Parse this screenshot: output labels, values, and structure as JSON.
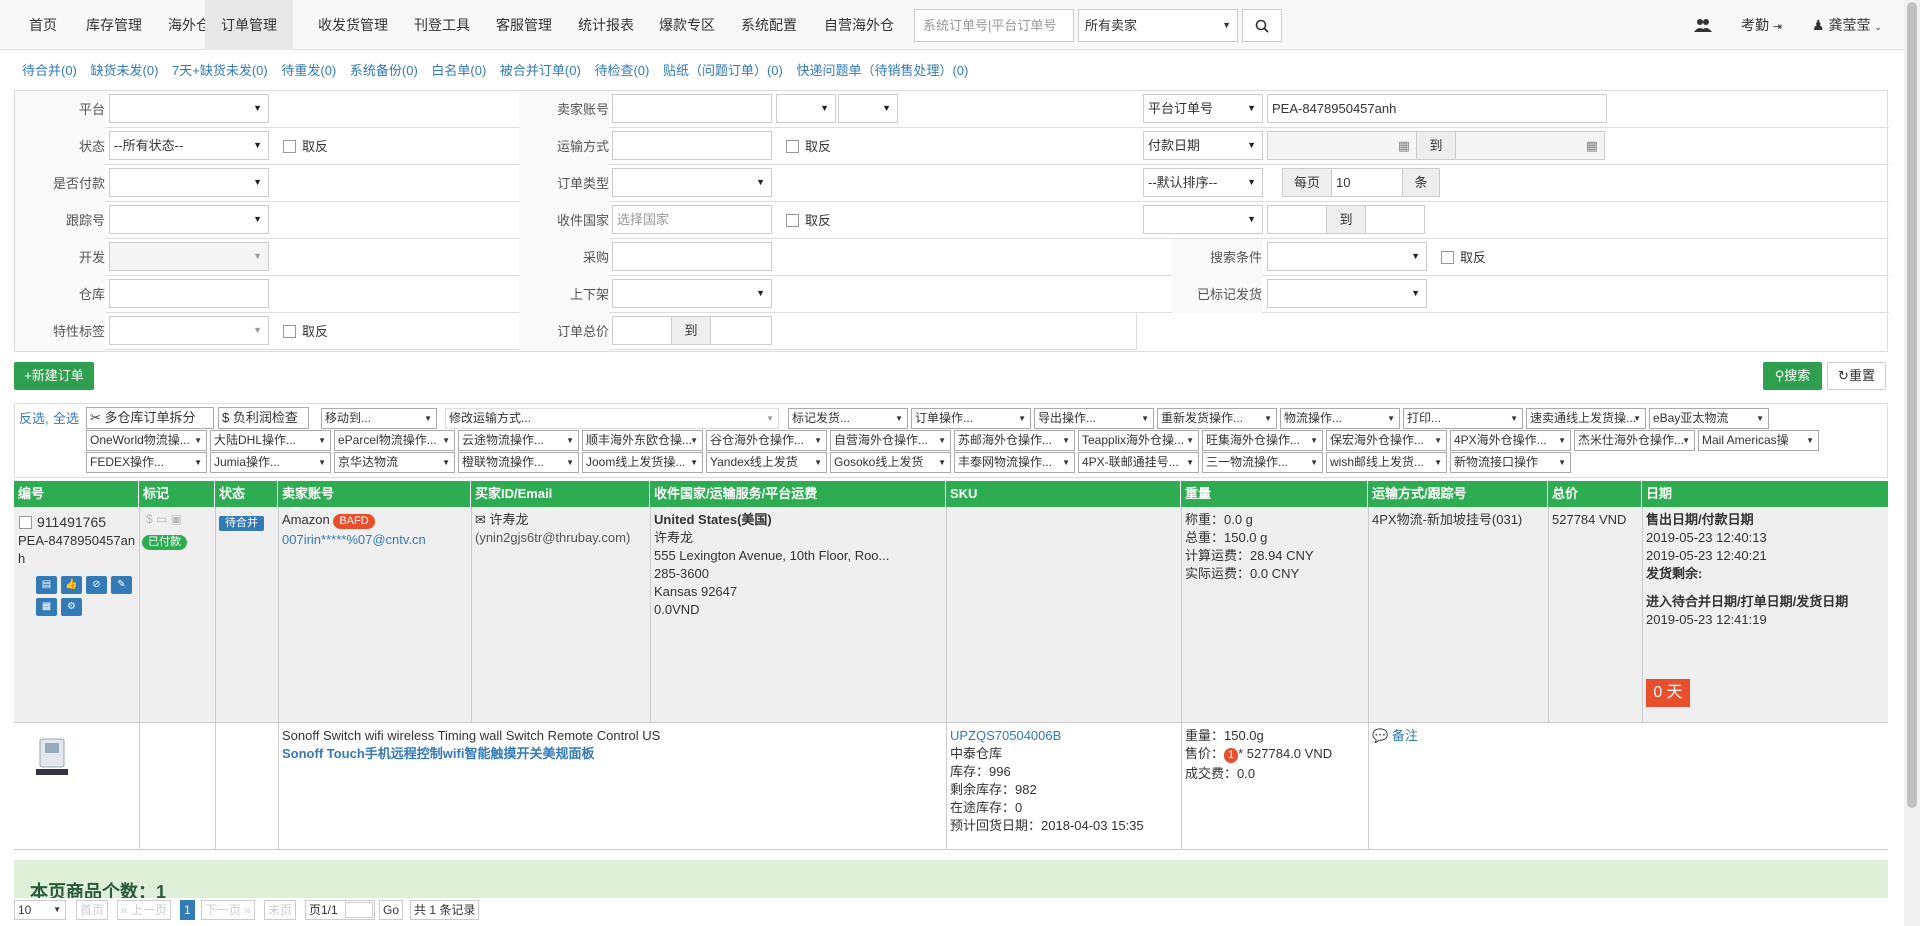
{
  "nav": {
    "items": [
      "首页",
      "库存管理",
      "海外仓",
      "订单管理",
      "收发货管理",
      "刊登工具",
      "客服管理",
      "统计报表",
      "爆款专区",
      "系统配置",
      "自营海外仓"
    ],
    "active_index": 3,
    "search_placeholder": "系统订单号|平台订单号",
    "seller_select": "所有卖家",
    "attendance": "考勤",
    "user": "龚莹莹"
  },
  "quick_links": [
    "待合并(0)",
    "缺货未发(0)",
    "7天+缺货未发(0)",
    "待重发(0)",
    "系统备份(0)",
    "白名单(0)",
    "被合并订单(0)",
    "待检查(0)",
    "贴纸（问题订单）(0)",
    "快递问题单（待销售处理）(0)"
  ],
  "filter": {
    "platform_label": "平台",
    "seller_account_label": "卖家账号",
    "platform_order_select": "平台订单号",
    "platform_order_value": "PEA-8478950457anh",
    "status_label": "状态",
    "status_value": "--所有状态--",
    "invert": "取反",
    "shipping_label": "运输方式",
    "pay_date_select": "付款日期",
    "to": "到",
    "paid_label": "是否付款",
    "order_type_label": "订单类型",
    "sort_select": "--默认排序--",
    "per_page_label": "每页",
    "per_page_value": "10",
    "per_page_unit": "条",
    "tracking_label": "跟踪号",
    "country_label": "收件国家",
    "country_placeholder": "选择国家",
    "dev_label": "开发",
    "purchase_label": "采购",
    "search_cond_label": "搜索条件",
    "warehouse_label": "仓库",
    "listing_label": "上下架",
    "marked_ship_label": "已标记发货",
    "tag_label": "特性标签",
    "total_label": "订单总价",
    "new_order": "+新建订单",
    "search": "搜索",
    "reset": "重置"
  },
  "toolbar": {
    "select_inverse": "反选",
    "select_all": "全选",
    "split": "多仓库订单拆分",
    "profit_check": "负利润检查",
    "move_to": "移动到...",
    "edit_shipping": "修改运输方式...",
    "row1": [
      "标记发货...",
      "订单操作...",
      "导出操作...",
      "重新发货操作...",
      "物流操作...",
      "打印...",
      "速卖通线上发货操...",
      "eBay亚太物流"
    ],
    "row2": [
      "OneWorld物流操...",
      "大陆DHL操作...",
      "eParcel物流操作...",
      "云途物流操作...",
      "顺丰海外东欧仓操...",
      "谷仓海外仓操作...",
      "自营海外仓操作...",
      "苏邮海外仓操作...",
      "Teapplix海外仓操...",
      "旺集海外仓操作...",
      "保宏海外仓操作...",
      "4PX海外仓操作...",
      "杰米仕海外仓操作...",
      "Mail Americas操"
    ],
    "row3": [
      "FEDEX操作...",
      "Jumia操作...",
      "京华达物流",
      "橙联物流操作...",
      "Joom线上发货操...",
      "Yandex线上发货",
      "Gosoko线上发货",
      "丰泰网物流操作...",
      "4PX-联邮通挂号...",
      "三一物流操作...",
      "wish邮线上发货...",
      "新物流接口操作"
    ]
  },
  "table": {
    "headers": [
      "编号",
      "标记",
      "状态",
      "卖家账号",
      "买家ID/Email",
      "收件国家/运输服务/平台运费",
      "SKU",
      "重量",
      "运输方式/跟踪号",
      "总价",
      "日期"
    ],
    "order": {
      "id": "911491765",
      "platform_order": "PEA-8478950457anh",
      "paid_badge": "已付款",
      "status_badge": "待合并",
      "seller_platform": "Amazon",
      "seller_tag": "BAFD",
      "seller_email": "007irin*****%07@cntv.cn",
      "buyer_name": "许寿龙",
      "buyer_email": "(ynin2gjs6tr@thrubay.com)",
      "country": "United States(美国)",
      "recipient": "许寿龙",
      "address": "555 Lexington Avenue, 10th Floor, Roo...",
      "phone": "285-3600",
      "city": "Kansas 92647",
      "freight": "0.0VND",
      "weight_net": "称重：0.0 g",
      "weight_total": "总重：150.0 g",
      "calc_fee": "计算运费：28.94 CNY",
      "actual_fee": "实际运费：0.0 CNY",
      "shipping": "4PX物流-新加坡挂号(031)",
      "total": "527784 VND",
      "date_label1": "售出日期/付款日期",
      "sold_date": "2019-05-23 12:40:13",
      "pay_date": "2019-05-23 12:40:21",
      "remain_label": "发货剩余:",
      "date_label2": "进入待合并日期/打单日期/发货日期",
      "merge_date": "2019-05-23 12:41:19",
      "days_badge": "0 天"
    },
    "item": {
      "title_en": "Sonoff Switch wifi wireless Timing wall Switch Remote Control US",
      "title_cn": "Sonoff Touch手机远程控制wifi智能触摸开关美规面板",
      "sku": "UPZQS70504006B",
      "warehouse": "中泰仓库",
      "stock": "库存：996",
      "remain_stock": "剩余库存：982",
      "in_transit": "在途库存：0",
      "eta": "预计回货日期：2018-04-03 15:35",
      "weight": "重量：150.0g",
      "price_prefix": "售价：",
      "price_badge": "1",
      "price": "* 527784.0 VND",
      "deal_fee": "成交费：0.0",
      "note": "备注"
    }
  },
  "summary": "本页商品个数：1",
  "pager": {
    "size": "10",
    "first": "首页",
    "prev": "上一页",
    "current": "1",
    "next": "下一页",
    "last": "末页",
    "page_info": "页1/1",
    "go": "Go",
    "total": "共 1 条记录"
  }
}
